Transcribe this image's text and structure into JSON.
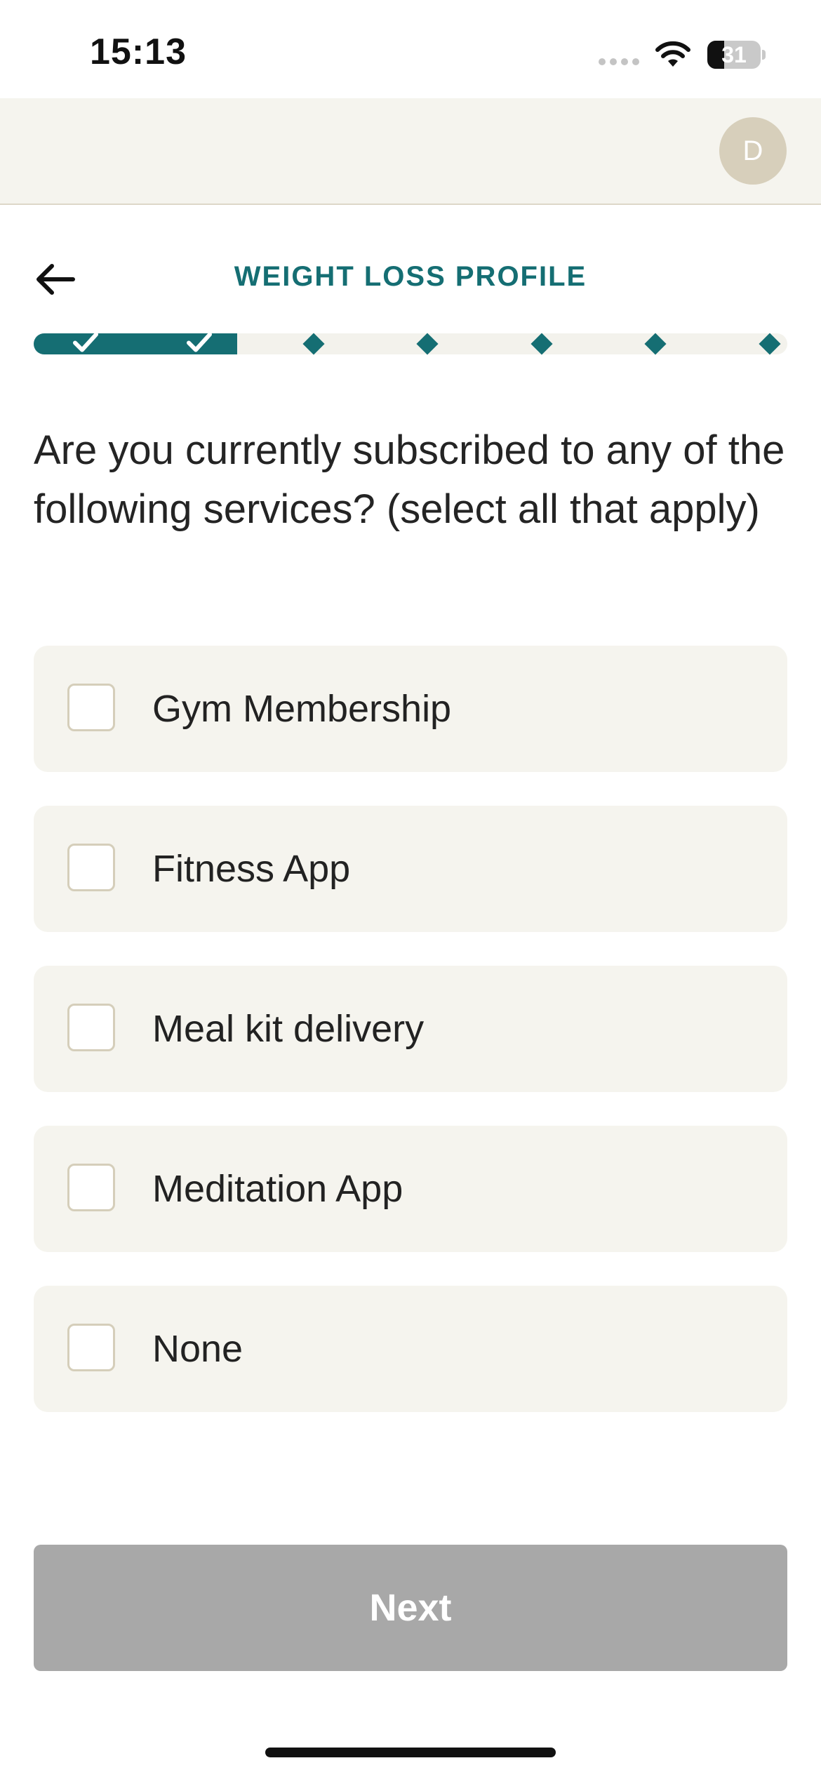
{
  "status_bar": {
    "time": "15:13",
    "battery_level": "31",
    "battery_fraction": 0.31,
    "icons": [
      "cellular-signal-icon",
      "wifi-icon",
      "battery-icon"
    ]
  },
  "header": {
    "avatar_initial": "D"
  },
  "page": {
    "title": "WEIGHT LOSS PROFILE",
    "back_icon": "arrow-left-icon"
  },
  "progress": {
    "total_steps": 7,
    "completed_steps": 2,
    "fraction_complete": 0.27,
    "completed_icon": "check-icon",
    "pending_icon": "diamond-icon"
  },
  "question": {
    "text": "Are you currently subscribed to any of the following services? (select all that apply)"
  },
  "options": [
    {
      "label": "Gym Membership",
      "checked": false
    },
    {
      "label": "Fitness App",
      "checked": false
    },
    {
      "label": "Meal kit delivery",
      "checked": false
    },
    {
      "label": "Meditation App",
      "checked": false
    },
    {
      "label": "None",
      "checked": false
    }
  ],
  "actions": {
    "next_label": "Next",
    "next_enabled": false
  },
  "colors": {
    "accent": "#156e73",
    "surface": "#f5f4ee",
    "checkbox_border": "#d5ceba",
    "disabled_button": "#a8a8a8",
    "avatar": "#d7cfbb"
  }
}
